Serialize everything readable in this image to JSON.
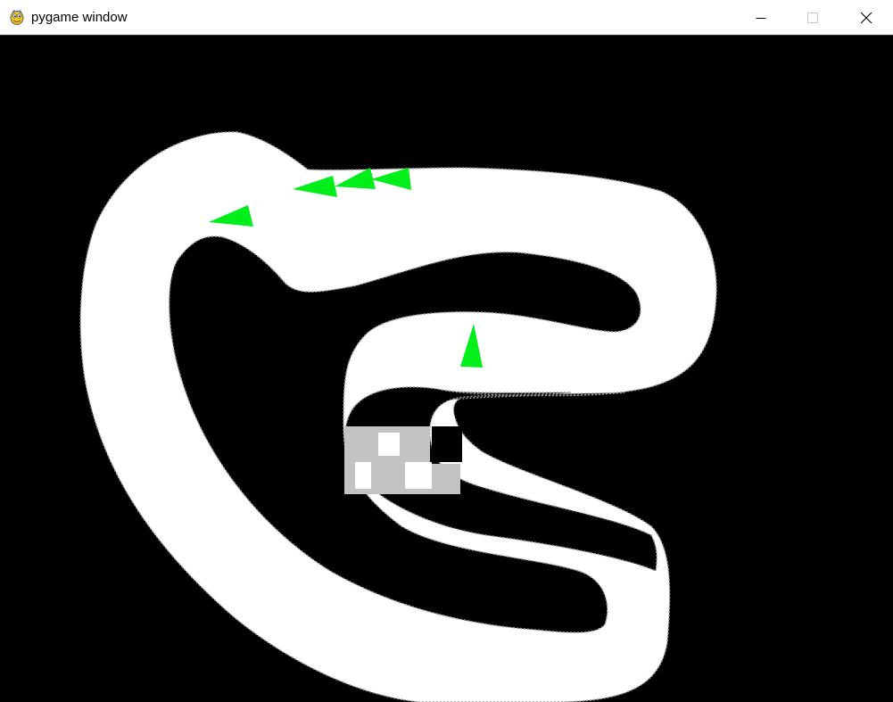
{
  "window": {
    "title": "pygame window",
    "icon": "pygame-snake-icon",
    "controls": {
      "minimize_icon": "minimize-icon",
      "maximize_icon": "maximize-icon",
      "close_icon": "close-icon"
    }
  },
  "game": {
    "background_color": "#000000",
    "track_color": "#ffffff",
    "track_edge_color": "#b0b0b0",
    "finish_line": {
      "dark_color": "#c3c3c3",
      "light_color": "#ffffff"
    },
    "car_color": "#00ee1a",
    "car_count": 5
  }
}
